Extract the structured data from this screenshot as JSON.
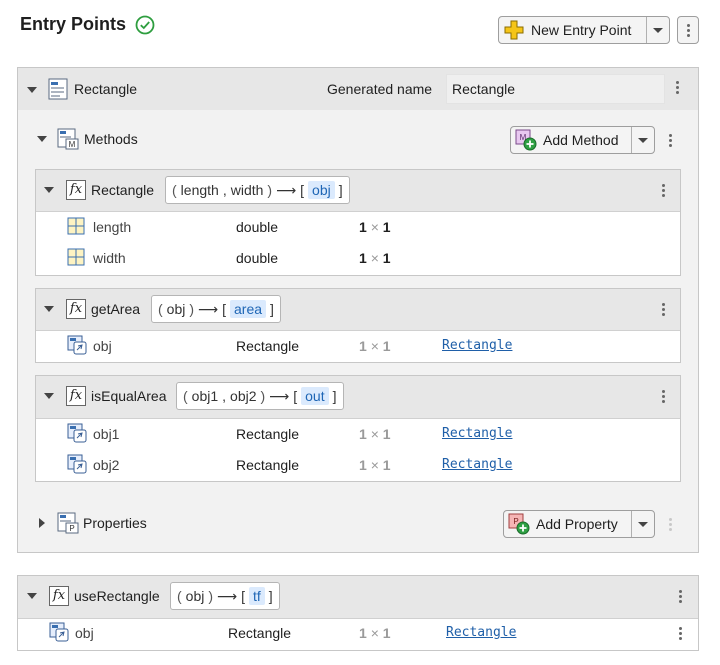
{
  "header": {
    "title": "Entry Points",
    "new_entry_label": "New Entry Point"
  },
  "rectangle_class": {
    "name": "Rectangle",
    "generated_name_label": "Generated name",
    "generated_name_value": "Rectangle",
    "methods_label": "Methods",
    "add_method_label": "Add Method",
    "properties_label": "Properties",
    "add_property_label": "Add Property",
    "functions": [
      {
        "name": "Rectangle",
        "inputs": [
          "length",
          "width"
        ],
        "output": "obj",
        "args": [
          {
            "name": "length",
            "type": "double",
            "size_a": "1",
            "size_x": "×",
            "size_b": "1",
            "link": ""
          },
          {
            "name": "width",
            "type": "double",
            "size_a": "1",
            "size_x": "×",
            "size_b": "1",
            "link": ""
          }
        ]
      },
      {
        "name": "getArea",
        "inputs": [
          "obj"
        ],
        "output": "area",
        "args": [
          {
            "name": "obj",
            "type": "Rectangle",
            "size_a": "1",
            "size_x": "×",
            "size_b": "1",
            "link": "Rectangle"
          }
        ]
      },
      {
        "name": "isEqualArea",
        "inputs": [
          "obj1",
          "obj2"
        ],
        "output": "out",
        "args": [
          {
            "name": "obj1",
            "type": "Rectangle",
            "size_a": "1",
            "size_x": "×",
            "size_b": "1",
            "link": "Rectangle"
          },
          {
            "name": "obj2",
            "type": "Rectangle",
            "size_a": "1",
            "size_x": "×",
            "size_b": "1",
            "link": "Rectangle"
          }
        ]
      }
    ]
  },
  "use_rectangle": {
    "name": "useRectangle",
    "inputs": [
      "obj"
    ],
    "output": "tf",
    "args": [
      {
        "name": "obj",
        "type": "Rectangle",
        "size_a": "1",
        "size_x": "×",
        "size_b": "1",
        "link": "Rectangle"
      }
    ]
  },
  "sig_glyphs": {
    "open": "(",
    "close": ")",
    "arrow": "⟶",
    "lbr": "[",
    "rbr": "]",
    "comma": ","
  },
  "colors": {
    "accent_link": "#1f5fa8",
    "output_highlight": "#dbeafd",
    "check_green": "#2e9e3f"
  }
}
